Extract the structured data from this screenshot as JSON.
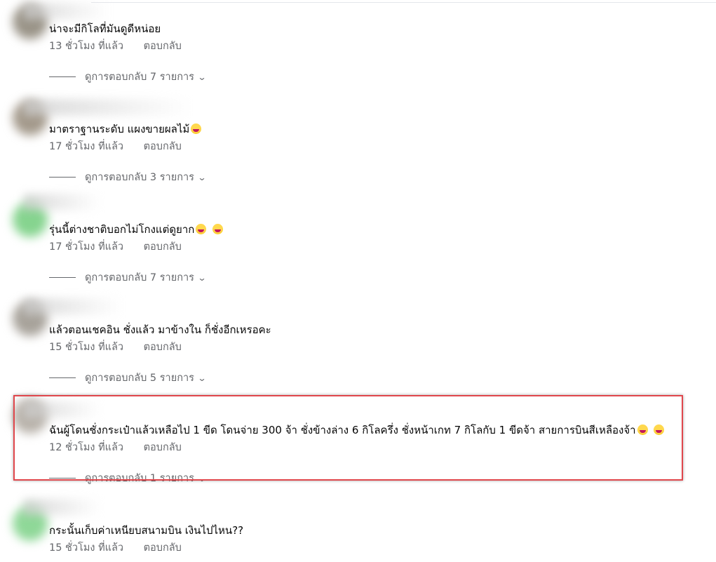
{
  "comments": [
    {
      "text": "น่าจะมีกิโลที่มันดูดีหน่อย",
      "time": "13 ชั่วโมง ที่แล้ว",
      "reply_label": "ตอบกลับ",
      "view_replies": "ดูการตอบกลับ 7 รายการ",
      "emoji_count": 0,
      "avatar_color": "#9a9488"
    },
    {
      "text": "มาตราฐานระดับ แผงขายผลไม้",
      "time": "17 ชั่วโมง ที่แล้ว",
      "reply_label": "ตอบกลับ",
      "view_replies": "ดูการตอบกลับ 3 รายการ",
      "emoji_count": 1,
      "avatar_color": "#a49a8c"
    },
    {
      "text": "รุ่นนี้ต่างชาติบอกไม่โกงแต่ดูยาก",
      "time": "17 ชั่วโมง ที่แล้ว",
      "reply_label": "ตอบกลับ",
      "view_replies": "ดูการตอบกลับ 7 รายการ",
      "emoji_count": 2,
      "avatar_color": "#86d48f"
    },
    {
      "text": "แล้วตอนเชคอิน ชั่งแล้ว มาข้างใน ก็ชั่งอีกเหรอคะ",
      "time": "15 ชั่วโมง ที่แล้ว",
      "reply_label": "ตอบกลับ",
      "view_replies": "ดูการตอบกลับ 5 รายการ",
      "emoji_count": 0,
      "avatar_color": "#a8a39b"
    },
    {
      "text": "ฉันผู้โดนชั่งกระเป๋าแล้วเหลือไป 1 ขีด โดนจ่าย 300 จ้า ชั่งข้างล่าง 6 กิโลครึ่ง ชั่งหน้าเกท 7 กิโลกับ 1 ขีดจ้า สายการบินสีเหลืองจ้า",
      "time": "12 ชั่วโมง ที่แล้ว",
      "reply_label": "ตอบกลับ",
      "view_replies": "ดูการตอบกลับ 1 รายการ",
      "emoji_count": 2,
      "avatar_color": "#b9b3ab"
    },
    {
      "text": "กระนั้นเก็บค่าเหนียบสนามบิน เงินไปไหน??",
      "time": "15 ชั่วโมง ที่แล้ว",
      "reply_label": "ตอบกลับ",
      "view_replies": "",
      "emoji_count": 0,
      "avatar_color": "#8fd898"
    }
  ],
  "highlight_color": "#e0474c"
}
